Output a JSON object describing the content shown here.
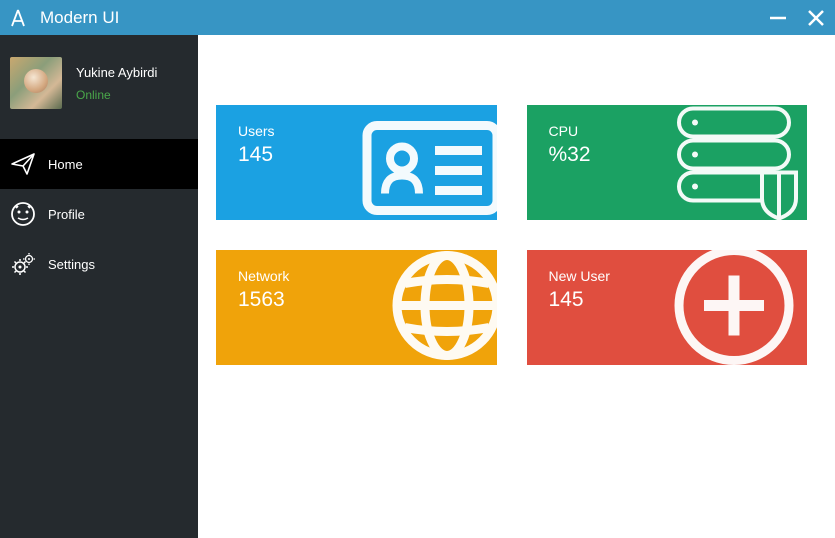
{
  "titlebar": {
    "title": "Modern UI"
  },
  "user": {
    "name": "Yukine Aybirdi",
    "status": "Online"
  },
  "nav": {
    "home": "Home",
    "profile": "Profile",
    "settings": "Settings"
  },
  "cards": {
    "users": {
      "label": "Users",
      "value": "145"
    },
    "cpu": {
      "label": "CPU",
      "value": "%32"
    },
    "network": {
      "label": "Network",
      "value": "1563"
    },
    "newuser": {
      "label": "New User",
      "value": "145"
    }
  }
}
